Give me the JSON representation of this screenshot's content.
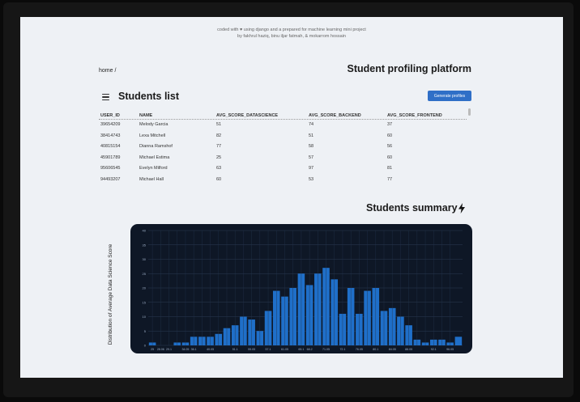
{
  "credits": {
    "line1": "coded with ♥ using django and a prepared for machine learning mini project",
    "line2": "by fakhrul haziq, binu iljar fatmah, & mokarrom hossain"
  },
  "breadcrumb": "home /",
  "platform_title": "Student profiling platform",
  "students_list": {
    "title": "Students list",
    "generate_button": "Generate profiles",
    "columns": [
      "USER_ID",
      "NAME",
      "AVG_SCORE_DATASCIENCE",
      "AVG_SCORE_BACKEND",
      "AVG_SCORE_FRONTEND"
    ],
    "rows": [
      [
        "39654209",
        "Melody Garcia",
        "51",
        "74",
        "37"
      ],
      [
        "38414743",
        "Lexa Mitchell",
        "82",
        "51",
        "60"
      ],
      [
        "40815154",
        "Dianna Ramshof",
        "77",
        "58",
        "56"
      ],
      [
        "45901789",
        "Michael Estima",
        "25",
        "57",
        "60"
      ],
      [
        "95606545",
        "Evelyn Milford",
        "63",
        "97",
        "81"
      ],
      [
        "94493207",
        "Michael Hall",
        "60",
        "53",
        "77"
      ]
    ]
  },
  "summary": {
    "title": "Students summary",
    "icon": "lightning-bolt-icon"
  },
  "chart_data": {
    "type": "bar",
    "ylabel": "Distribution of Average Data Science Score",
    "xlabel": "",
    "x_tick_labels": [
      "25",
      "28.06",
      "29.1",
      "",
      "34.05",
      "36.1",
      "",
      "40.05",
      "",
      "",
      "51.1",
      "",
      "55.05",
      "",
      "57.1",
      "",
      "61.05",
      "",
      "65.1",
      "68.2",
      "",
      "71.05",
      "",
      "72.1",
      "",
      "76.05",
      "",
      "80.1",
      "",
      "84.05",
      "",
      "88.05",
      "",
      "",
      "92.1",
      "",
      "96.05"
    ],
    "y_tick_labels": [
      "0",
      "5",
      "10",
      "15",
      "20",
      "25",
      "30",
      "35",
      "40"
    ],
    "ylim": [
      0,
      40
    ],
    "values": [
      1,
      0,
      0,
      1,
      1,
      3,
      3,
      3,
      4,
      6,
      7,
      10,
      9,
      5,
      12,
      19,
      17,
      20,
      25,
      21,
      25,
      27,
      23,
      11,
      20,
      11,
      19,
      20,
      12,
      13,
      10,
      7,
      2,
      1,
      2,
      2,
      1,
      3
    ],
    "grid": true,
    "bar_color": "#1f6fc9",
    "background": "#0e1726"
  }
}
